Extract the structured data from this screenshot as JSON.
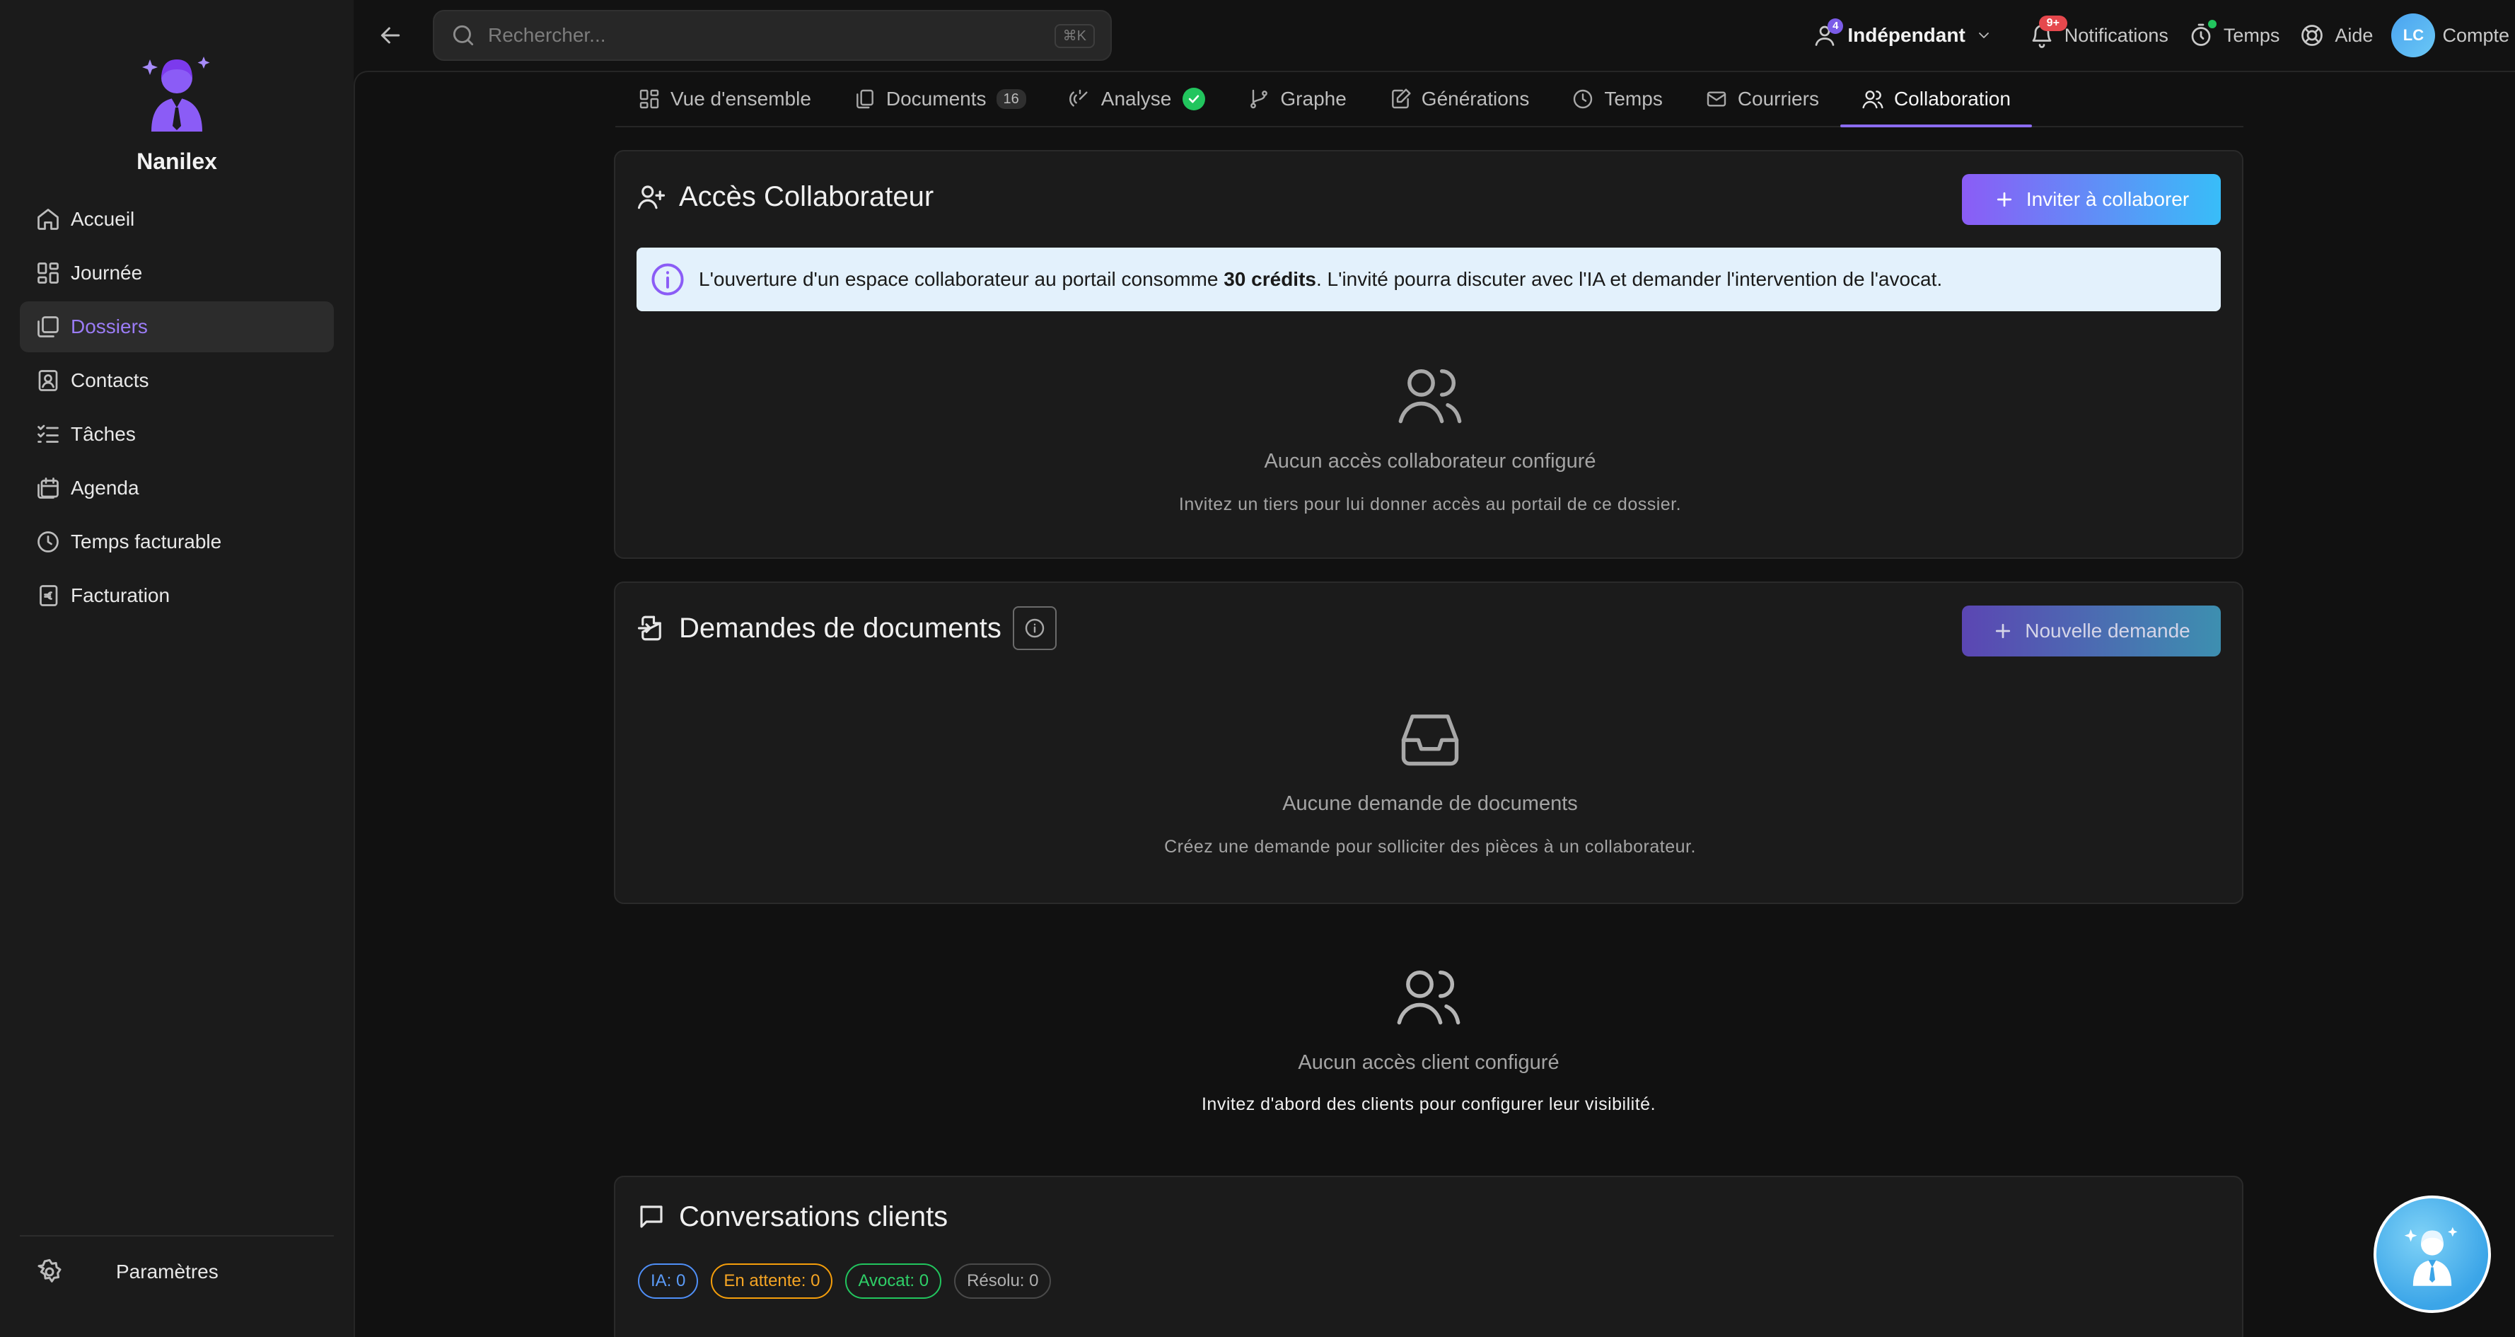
{
  "app": {
    "name": "Nanilex"
  },
  "sidebar": {
    "items": [
      {
        "label": "Accueil",
        "icon": "home-icon",
        "active": false
      },
      {
        "label": "Journée",
        "icon": "dashboard-grid-icon",
        "active": false
      },
      {
        "label": "Dossiers",
        "icon": "folders-icon",
        "active": true
      },
      {
        "label": "Contacts",
        "icon": "contact-book-icon",
        "active": false
      },
      {
        "label": "Tâches",
        "icon": "tasks-list-icon",
        "active": false
      },
      {
        "label": "Agenda",
        "icon": "calendar-icon",
        "active": false
      },
      {
        "label": "Temps facturable",
        "icon": "clock-icon",
        "active": false
      },
      {
        "label": "Facturation",
        "icon": "euro-invoice-icon",
        "active": false
      }
    ],
    "settings_label": "Paramètres"
  },
  "topbar": {
    "search_placeholder": "Rechercher...",
    "search_shortcut": "⌘K",
    "plan_label": "Indépendant",
    "plan_badge": "4",
    "notifications_label": "Notifications",
    "notifications_badge": "9+",
    "time_label": "Temps",
    "help_label": "Aide",
    "avatar_initials": "LC",
    "account_label": "Compte"
  },
  "tabs": [
    {
      "label": "Vue d'ensemble",
      "icon": "overview-grid-icon"
    },
    {
      "label": "Documents",
      "icon": "documents-icon",
      "count": "16"
    },
    {
      "label": "Analyse",
      "icon": "analysis-icon",
      "check": true
    },
    {
      "label": "Graphe",
      "icon": "git-branch-icon"
    },
    {
      "label": "Générations",
      "icon": "edit-doc-icon"
    },
    {
      "label": "Temps",
      "icon": "clock-icon"
    },
    {
      "label": "Courriers",
      "icon": "mail-icon"
    },
    {
      "label": "Collaboration",
      "icon": "users-icon",
      "active": true
    }
  ],
  "collaborator_card": {
    "title": "Accès Collaborateur",
    "invite_button": "Inviter à collaborer",
    "banner_prefix": "L'ouverture d'un espace collaborateur au portail consomme ",
    "banner_bold": "30 crédits",
    "banner_suffix": ". L'invité pourra discuter avec l'IA et demander l'intervention de l'avocat.",
    "empty_title": "Aucun accès collaborateur configuré",
    "empty_sub": "Invitez un tiers pour lui donner accès au portail de ce dossier."
  },
  "documents_card": {
    "title": "Demandes de documents",
    "new_button": "Nouvelle demande",
    "empty_title": "Aucune demande de documents",
    "empty_sub": "Créez une demande pour solliciter des pièces à un collaborateur."
  },
  "client_access": {
    "empty_title": "Aucun accès client configuré",
    "empty_sub": "Invitez d'abord des clients pour configurer leur visibilité."
  },
  "conversations_card": {
    "title": "Conversations clients",
    "pills": [
      {
        "label": "IA: 0",
        "color": "#4f8ff7"
      },
      {
        "label": "En attente: 0",
        "color": "#f59e0b"
      },
      {
        "label": "Avocat: 0",
        "color": "#22c55e"
      },
      {
        "label": "Résolu: 0",
        "color": "#9a9a9a"
      }
    ]
  },
  "colors": {
    "accent": "#8b5cf6",
    "accent_text": "#9b7cf6",
    "success": "#22c55e",
    "danger": "#e5484d"
  }
}
